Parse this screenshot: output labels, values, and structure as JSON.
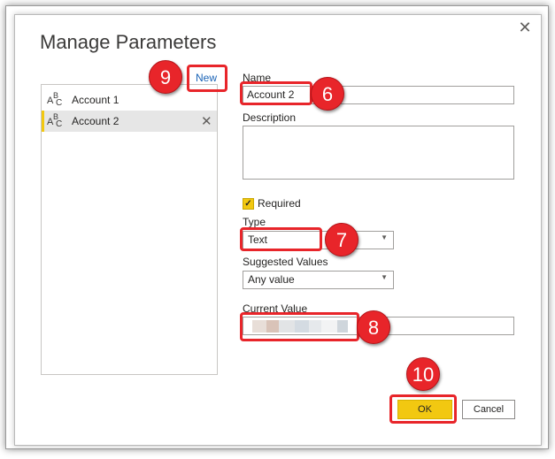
{
  "dialog": {
    "title": "Manage Parameters",
    "close_glyph": "✕"
  },
  "sidebar": {
    "new_link": "New",
    "items": [
      {
        "label": "Account 1",
        "icon": "abc-text-icon",
        "selected": false
      },
      {
        "label": "Account 2",
        "icon": "abc-text-icon",
        "selected": true,
        "delete_glyph": "✕"
      }
    ],
    "icon_glyphs": {
      "a": "A",
      "b": "B",
      "c": "C"
    }
  },
  "form": {
    "name_label": "Name",
    "name_value": "Account 2",
    "description_label": "Description",
    "description_value": "",
    "required_label": "Required",
    "required_checked": true,
    "type_label": "Type",
    "type_value": "Text",
    "suggested_label": "Suggested Values",
    "suggested_value": "Any value",
    "current_label": "Current Value"
  },
  "buttons": {
    "ok_label": "OK",
    "cancel_label": "Cancel"
  },
  "callouts": {
    "six": "6",
    "seven": "7",
    "eight": "8",
    "nine": "9",
    "ten": "10"
  },
  "colors": {
    "accent": "#f2c811",
    "callout": "#e8252a",
    "link": "#1a63b6"
  }
}
